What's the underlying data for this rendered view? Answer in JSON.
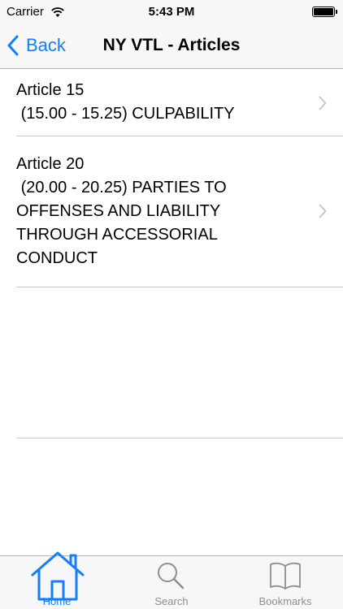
{
  "status_bar": {
    "carrier": "Carrier",
    "time": "5:43 PM",
    "battery_level": 1.0
  },
  "nav": {
    "back_label": "Back",
    "title": "NY VTL - Articles"
  },
  "list": {
    "items": [
      {
        "heading": "Article 15",
        "text": "Article 15\n (15.00 - 15.25) CULPABILITY"
      },
      {
        "heading": "Article 20",
        "text": "Article 20\n (20.00 - 20.25) PARTIES TO\nOFFENSES AND LIABILITY\nTHROUGH ACCESSORIAL\nCONDUCT"
      }
    ]
  },
  "tab_bar": {
    "tabs": [
      {
        "label": "Home",
        "icon": "house-icon",
        "selected": true
      },
      {
        "label": "Search",
        "icon": "magnifier-icon",
        "selected": false
      },
      {
        "label": "Bookmarks",
        "icon": "book-icon",
        "selected": false
      }
    ]
  },
  "colors": {
    "accent": "#147efb",
    "inactive": "#8e8e93",
    "bar_background": "#f7f7f7",
    "separator": "#c8c7cc"
  }
}
